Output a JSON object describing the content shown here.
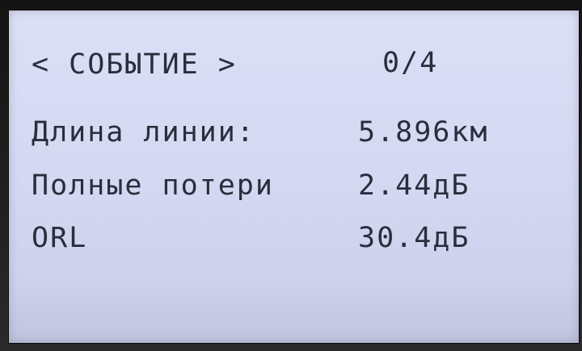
{
  "header": {
    "title": "< СОБЫТИЕ >",
    "counter": "0/4"
  },
  "rows": [
    {
      "label": "Длина линии:",
      "value": "5.896км"
    },
    {
      "label": "Полные потери",
      "value": "2.44дБ"
    },
    {
      "label": "ORL",
      "value": "30.4дБ"
    }
  ],
  "colors": {
    "screen_background": "#d8dbf3",
    "text": "#2a2d3b",
    "bezel": "#141414"
  }
}
